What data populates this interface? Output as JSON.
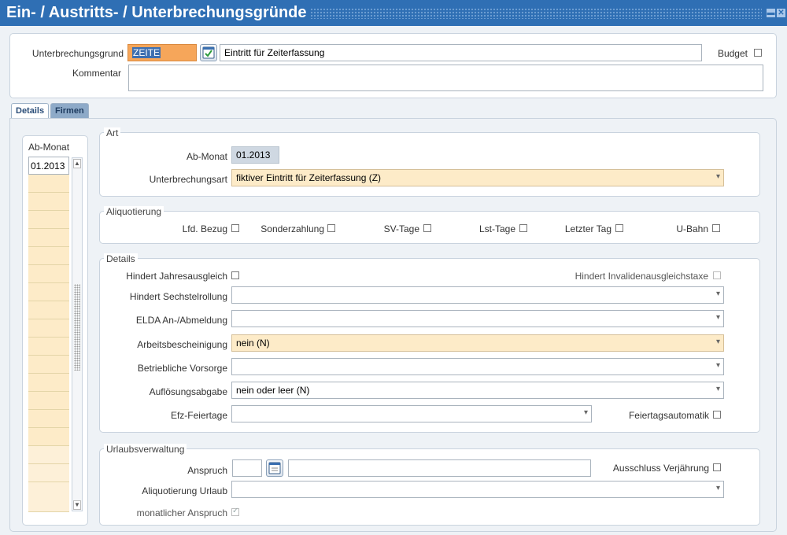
{
  "window": {
    "title": "Ein- / Austritts- / Unterbrechungsgründe"
  },
  "header": {
    "grund_label": "Unterbrechungsgrund",
    "grund_code": "ZEITE",
    "grund_description": "Eintritt für Zeiterfassung",
    "budget_label": "Budget",
    "kommentar_label": "Kommentar",
    "kommentar_value": ""
  },
  "tabs": [
    {
      "label": "Details"
    },
    {
      "label": "Firmen"
    }
  ],
  "month_list": {
    "header": "Ab-Monat",
    "items": [
      "01.2013"
    ]
  },
  "art": {
    "legend": "Art",
    "ab_monat_label": "Ab-Monat",
    "ab_monat_value": "01.2013",
    "unterbrechungsart_label": "Unterbrechungsart",
    "unterbrechungsart_value": "fiktiver Eintritt für Zeiterfassung (Z)"
  },
  "aliquotierung": {
    "legend": "Aliquotierung",
    "items": [
      "Lfd. Bezug",
      "Sonderzahlung",
      "SV-Tage",
      "Lst-Tage",
      "Letzter Tag",
      "U-Bahn"
    ]
  },
  "details": {
    "legend": "Details",
    "jahresausgleich_label": "Hindert Jahresausgleich",
    "invalidenausgleich_label": "Hindert Invalidenausgleichstaxe",
    "sechstel_label": "Hindert Sechstelrollung",
    "sechstel_value": "",
    "elda_label": "ELDA An-/Abmeldung",
    "elda_value": "",
    "arbeits_label": "Arbeitsbescheinigung",
    "arbeits_value": "nein (N)",
    "vorsorge_label": "Betriebliche Vorsorge",
    "vorsorge_value": "",
    "aufloesung_label": "Auflösungsabgabe",
    "aufloesung_value": "nein oder leer (N)",
    "efz_label": "Efz-Feiertage",
    "efz_value": "",
    "feiertag_label": "Feiertagsautomatik"
  },
  "urlaub": {
    "legend": "Urlaubsverwaltung",
    "anspruch_label": "Anspruch",
    "anspruch_value": "",
    "anspruch_text": "",
    "verjaehrung_label": "Ausschluss Verjährung",
    "aliquot_label": "Aliquotierung Urlaub",
    "aliquot_value": "",
    "monatlich_label": "monatlicher Anspruch"
  },
  "colors": {
    "titlebar": "#2f6fb4",
    "mandatory_field": "#fdebc8",
    "selected_code_field": "#f6a65a"
  }
}
